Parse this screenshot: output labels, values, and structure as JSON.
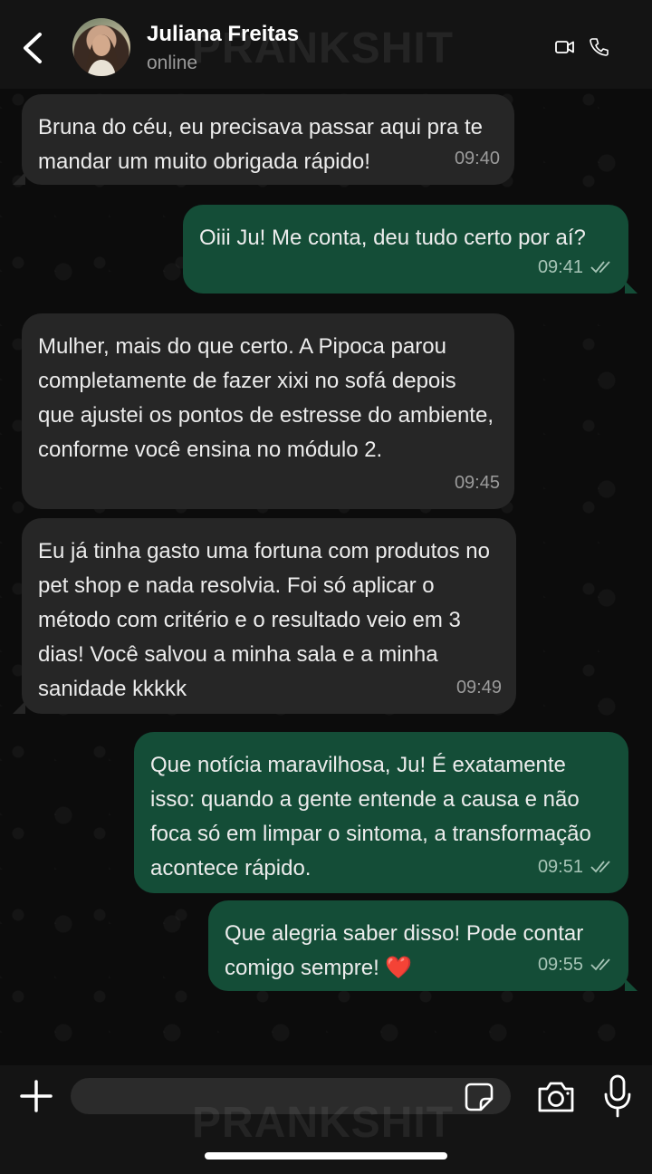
{
  "header": {
    "contact_name": "Juliana Freitas",
    "status": "online",
    "icons": [
      "back-arrow-icon",
      "video-call-icon",
      "phone-icon"
    ]
  },
  "watermark": "PRANKSHIT",
  "messages": [
    {
      "direction": "in",
      "text": "Bruna do céu, eu precisava passar aqui pra te mandar um muito obrigada rápido!",
      "time": "09:40"
    },
    {
      "direction": "out",
      "text": "Oiii Ju! Me conta, deu tudo certo por aí?",
      "time": "09:41",
      "read": true
    },
    {
      "direction": "in",
      "text": "Mulher, mais do que certo. A Pipoca parou completamente de fazer xixi no sofá depois que ajustei os pontos de estresse do ambiente, conforme você ensina no módulo 2.",
      "time": "09:45"
    },
    {
      "direction": "in",
      "text": "Eu já tinha gasto uma fortuna com produtos no pet shop e nada resolvia. Foi só aplicar o método com critério e o resultado veio em 3 dias! Você salvou a minha sala e a minha sanidade kkkkk",
      "time": "09:49"
    },
    {
      "direction": "out",
      "text": "Que notícia maravilhosa, Ju! É exatamente isso: quando a gente entende a causa e não foca só em limpar o sintoma, a transformação acontece rápido.",
      "time": "09:51",
      "read": true
    },
    {
      "direction": "out",
      "text": "Que alegria saber disso! Pode contar comigo sempre! ❤️",
      "time": "09:55",
      "read": true
    }
  ],
  "composer": {
    "input_value": "",
    "icons": [
      "plus-icon",
      "sticker-icon",
      "camera-icon",
      "microphone-icon"
    ]
  },
  "colors": {
    "incoming_bubble": "#262626",
    "outgoing_bubble": "#144d37",
    "header": "#141414",
    "read_ticks": "#a6c4b6"
  }
}
